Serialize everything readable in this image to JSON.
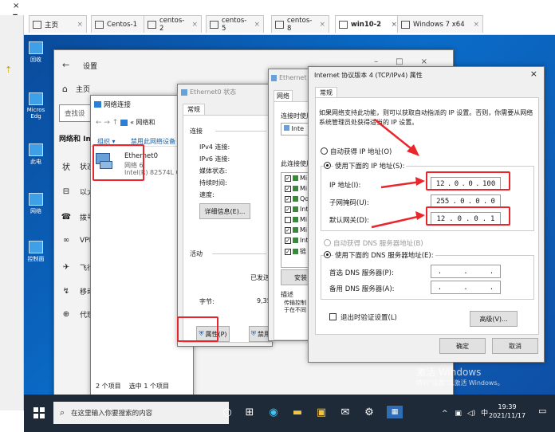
{
  "browser_tabs": [
    {
      "label": "主页",
      "active": false
    },
    {
      "label": "Centos-1",
      "active": false
    },
    {
      "label": "centos-2",
      "active": false
    },
    {
      "label": "centos-5",
      "active": false
    },
    {
      "label": "centos-8",
      "active": false
    },
    {
      "label": "win10-2",
      "active": true
    },
    {
      "label": "Windows 7 x64",
      "active": false
    }
  ],
  "desktop_icons": [
    "回收",
    "Micros Edg",
    "此电",
    "网络",
    "控制面"
  ],
  "settings": {
    "title": "设置",
    "home": "主页",
    "search_placeholder": "查找设",
    "section": "网络和 In",
    "items": [
      "状态",
      "以太",
      "拨号",
      "VPN",
      "飞行",
      "移动",
      "代理"
    ],
    "item_icons": [
      "状",
      "⊟",
      "☎",
      "∞",
      "✈",
      "↯",
      "⊕"
    ]
  },
  "netconn": {
    "title": "网络连接",
    "breadcrumb": "« 网络和",
    "toolbar_organize": "组织 ▾",
    "toolbar_disable": "禁用此网络设备",
    "adapter_name": "Ethernet0",
    "adapter_net": "网络 6",
    "adapter_device": "Intel(R) 82574L Gig",
    "status": "2 个项目    选中 1 个项目"
  },
  "status_dialog": {
    "title": "Ethernet0 状态",
    "tab": "常规",
    "connection": "连接",
    "ipv4": "IPv4 连接:",
    "ipv6": "IPv6 连接:",
    "media": "媒体状态:",
    "duration": "持续时间:",
    "speed": "速度:",
    "details_btn": "详细信息(E)...",
    "activity": "活动",
    "sent": "已发送",
    "bytes": "字节:",
    "bytes_val": "9,35",
    "properties_btn": "属性(P)",
    "disable_btn": "禁用"
  },
  "props_dialog": {
    "title": "Ethernet",
    "tab": "网络",
    "connect_using": "连接时使用",
    "adapter": "Inte",
    "items_label": "此连接使用",
    "items": [
      "Mi",
      "Mi",
      "Qo",
      "Int",
      "Mi",
      "Mi",
      "Int",
      "链"
    ],
    "items_checked": [
      true,
      true,
      true,
      true,
      false,
      true,
      true,
      true
    ],
    "install_btn": "安装",
    "desc_label": "描述",
    "desc": "传输控制 于在不同"
  },
  "ipv4": {
    "title": "Internet 协议版本 4 (TCP/IPv4) 属性",
    "tab": "常规",
    "intro": "如果网络支持此功能，则可以获取自动指派的 IP 设置。否则，你需要从网络系统管理员处获得适当的 IP 设置。",
    "auto_ip": "自动获得 IP 地址(O)",
    "manual_ip": "使用下面的 IP 地址(S):",
    "ip_label": "IP 地址(I):",
    "ip_value": [
      "12",
      ".",
      "0",
      ".",
      "0",
      ".",
      "100"
    ],
    "mask_label": "子网掩码(U):",
    "mask_value": [
      "255",
      ".",
      "0",
      ".",
      "0",
      ".",
      "0"
    ],
    "gw_label": "默认网关(D):",
    "gw_value": [
      "12",
      ".",
      "0",
      ".",
      "0",
      ".",
      "1"
    ],
    "auto_dns": "自动获得 DNS 服务器地址(B)",
    "manual_dns": "使用下面的 DNS 服务器地址(E):",
    "dns1_label": "首选 DNS 服务器(P):",
    "dns2_label": "备用 DNS 服务器(A):",
    "dns_dots": ".     .     .",
    "validate": "退出时验证设置(L)",
    "advanced_btn": "高级(V)...",
    "ok_btn": "确定",
    "cancel_btn": "取消"
  },
  "watermark": {
    "line1": "激活 Windows",
    "line2": "转到\"设置\"以激活 Windows。"
  },
  "taskbar": {
    "search": "在这里输入你要搜索的内容",
    "time": "19:39",
    "date": "2021/11/17",
    "ime": "中"
  },
  "colors": {
    "accent": "#0063b1",
    "annotation": "#e8262c"
  }
}
